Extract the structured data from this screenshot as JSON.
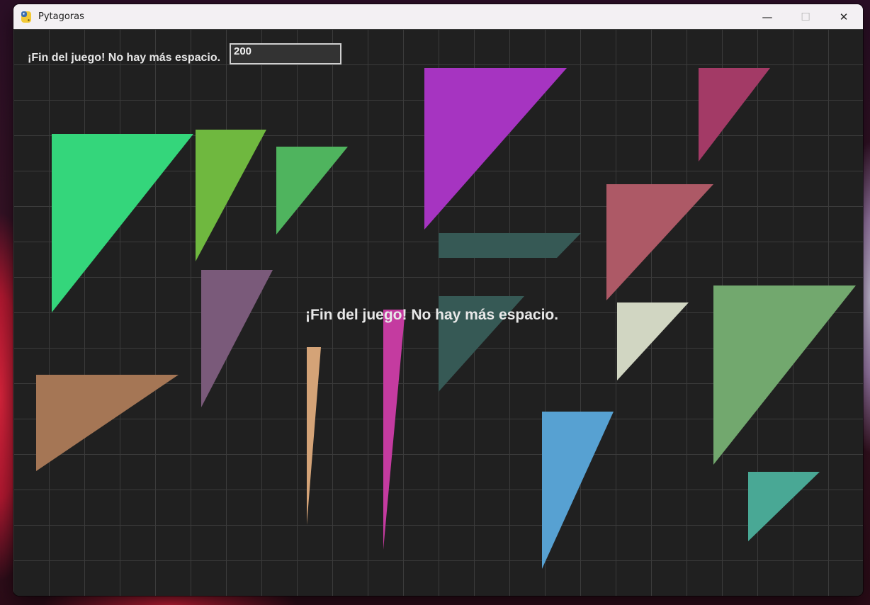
{
  "window": {
    "title": "Pytagoras",
    "controls": {
      "minimize": "—",
      "maximize": "☐",
      "close": "✕"
    }
  },
  "hud": {
    "message": "¡Fin del juego! No hay más espacio.",
    "input_value": "200"
  },
  "game_over_message": "¡Fin del juego! No hay más espacio.",
  "triangles": [
    {
      "name": "green-large",
      "color": "#34d67b"
    },
    {
      "name": "olive-green",
      "color": "#6fb83f"
    },
    {
      "name": "medium-green",
      "color": "#4fb45e"
    },
    {
      "name": "purple",
      "color": "#a634c1"
    },
    {
      "name": "crimson",
      "color": "#a33a66"
    },
    {
      "name": "rose",
      "color": "#ad5966"
    },
    {
      "name": "dark-teal-top",
      "color": "#365955"
    },
    {
      "name": "dark-teal-bottom",
      "color": "#365955"
    },
    {
      "name": "mauve",
      "color": "#7a5a7a"
    },
    {
      "name": "brown",
      "color": "#a57655"
    },
    {
      "name": "tan-sliver",
      "color": "#d4a377"
    },
    {
      "name": "magenta-sliver",
      "color": "#c43ba0"
    },
    {
      "name": "light-sage",
      "color": "#d1d6c2"
    },
    {
      "name": "sage-large",
      "color": "#72a86e"
    },
    {
      "name": "blue",
      "color": "#57a1d2"
    },
    {
      "name": "teal",
      "color": "#49a895"
    }
  ]
}
